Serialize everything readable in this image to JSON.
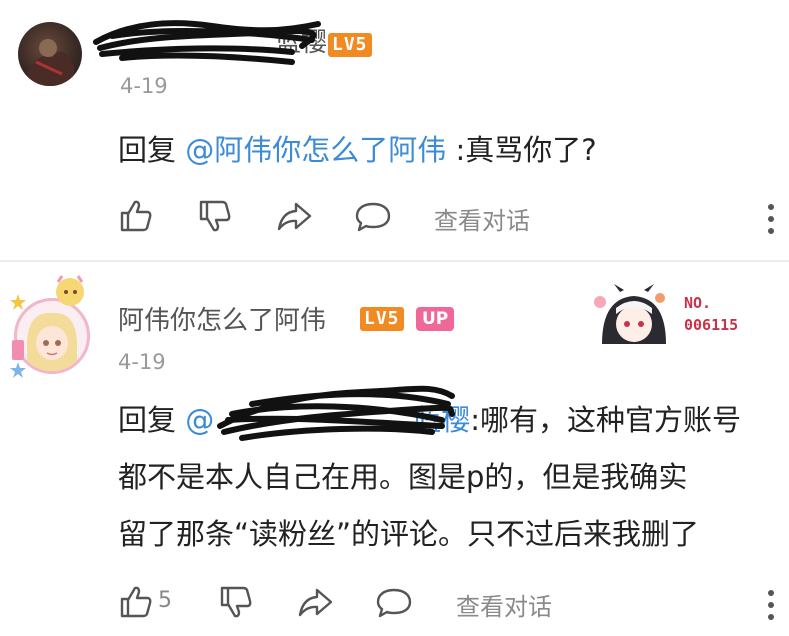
{
  "comments": [
    {
      "username_suffix": "蓝樱",
      "level_badge": "LV5",
      "date": "4-19",
      "reply_prefix": "回复",
      "mention": "@阿伟你怎么了阿伟",
      "text": ":真骂你了?",
      "like_count": "",
      "reply_label": "查看对话"
    },
    {
      "username": "阿伟你怎么了阿伟",
      "level_badge": "LV5",
      "up_badge": "UP",
      "fan_badge_label": "NO.",
      "fan_badge_number": "006115",
      "date": "4-19",
      "reply_prefix": "回复",
      "mention_visible": "@",
      "mention_suffix": "蓝樱",
      "text_lines": [
        ":哪有，这种官方账号",
        "都不是本人自己在用。图是p的，但是我确实",
        "留了那条“读粉丝”的评论。只不过后来我删了"
      ],
      "like_count": "5",
      "reply_label": "查看对话"
    }
  ],
  "icons": [
    "thumb-up-icon",
    "thumb-down-icon",
    "share-icon",
    "comment-icon",
    "more-vertical-icon"
  ],
  "colors": {
    "mention": "#3b8bd6",
    "level_badge": "#f28a24",
    "up_badge": "#f0679a"
  }
}
